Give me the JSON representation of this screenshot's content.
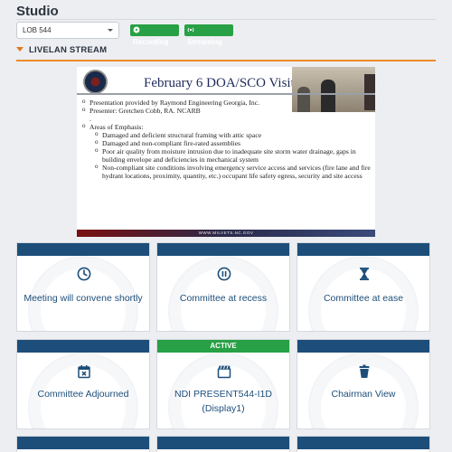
{
  "page": {
    "title": "Studio"
  },
  "room_select": {
    "value": "LOB 544"
  },
  "badges": {
    "recording": "Recording",
    "streaming": "Streaming"
  },
  "colors": {
    "primary": "#1d4e7a",
    "active": "#28a045",
    "accent": "#ef8a2a"
  },
  "section": {
    "title": "LIVELAN STREAM"
  },
  "stream_slide": {
    "title": "February 6 DOA/SCO Visit",
    "bullets": [
      "Presentation provided by Raymond Engineering Georgia, Inc.",
      "Presenter:  Gretchen Cobb, RA. NCARB",
      ".",
      "Areas of Emphasis:"
    ],
    "sub_bullets": [
      "Damaged and deficient structural framing with attic space",
      "Damaged and non-compliant fire-rated assemblies",
      "Poor air quality from moisture intrusion due to inadequate site storm water drainage, gaps in building envelope and deficiencies in mechanical system",
      "Non-compliant site conditions involving emergency service access and services (fire lane and fire hydrant locations, proximity, quantity, etc.) occupant life safety egress, security and site access"
    ],
    "footer": "WWW.MILVETS.NC.GOV"
  },
  "tiles": [
    {
      "label": "Meeting will convene shortly",
      "icon": "clock-icon",
      "active": false
    },
    {
      "label": "Committee at recess",
      "icon": "pause-circle-icon",
      "active": false
    },
    {
      "label": "Committee at ease",
      "icon": "hourglass-icon",
      "active": false
    },
    {
      "label": "Committee Adjourned",
      "icon": "calendar-x-icon",
      "active": false
    },
    {
      "label": "NDI PRESENT544-I1D (Display1)",
      "icon": "clapperboard-icon",
      "active": true,
      "status": "ACTIVE"
    },
    {
      "label": "Chairman View",
      "icon": "cup-icon",
      "active": false
    }
  ]
}
